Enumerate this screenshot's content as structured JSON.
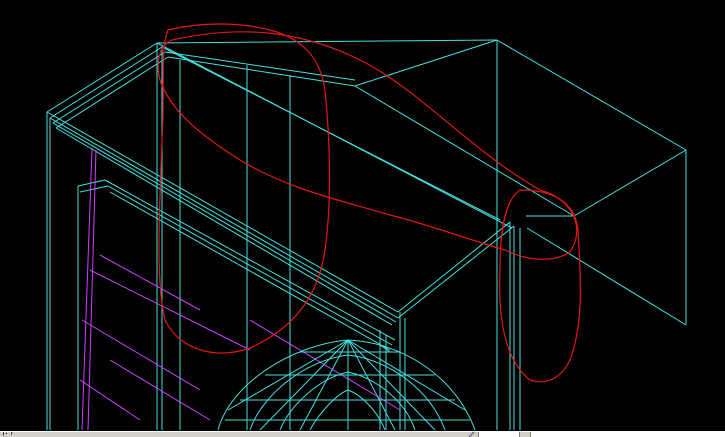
{
  "viewport": {
    "background": "#000000",
    "wire_color": "#44e0e0",
    "magenta_color": "#d040ff",
    "annotation_color": "#e01818"
  },
  "status_bar": {
    "text": "¦: /"
  }
}
